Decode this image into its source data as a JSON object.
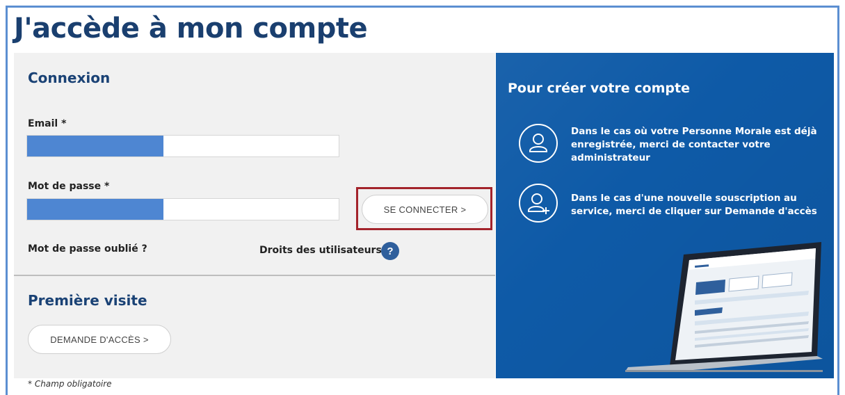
{
  "page": {
    "title": "J'accède à mon compte"
  },
  "login": {
    "section_title": "Connexion",
    "email_label": "Email *",
    "password_label": "Mot de passe *",
    "submit_label": "SE CONNECTER >",
    "forgot_password": "Mot de passe oublié ?",
    "user_rights": "Droits des utilisateurs",
    "help_glyph": "?"
  },
  "first_visit": {
    "section_title": "Première visite",
    "request_access_label": "DEMANDE D'ACCÈS >"
  },
  "footnote": "* Champ obligatoire",
  "info_panel": {
    "title": "Pour créer votre compte",
    "items": [
      {
        "icon": "user-icon",
        "text": "Dans le cas où votre Personne Morale est déjà enregistrée, merci de contacter votre administrateur"
      },
      {
        "icon": "user-add-icon",
        "text": "Dans le cas d'une nouvelle souscription au service, merci de cliquer sur Demande d'accès"
      }
    ]
  },
  "colors": {
    "brand_blue": "#0e5aa7",
    "title_blue": "#1a3f6f",
    "masked_input": "#4e86d2",
    "highlight_red": "#a3232b"
  }
}
